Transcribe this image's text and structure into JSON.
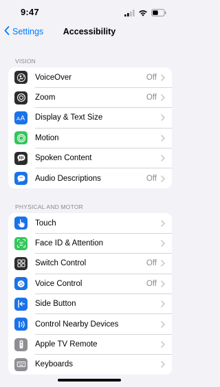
{
  "status_bar": {
    "time": "9:47"
  },
  "nav": {
    "back_label": "Settings",
    "title": "Accessibility"
  },
  "colors": {
    "accent": "#007aff",
    "background": "#f2f2f7",
    "secondary_text": "#8a8a8e"
  },
  "sections": [
    {
      "header": "VISION",
      "items": [
        {
          "label": "VoiceOver",
          "value": "Off",
          "icon": "voiceover-icon",
          "icon_color": "#2c2c2e"
        },
        {
          "label": "Zoom",
          "value": "Off",
          "icon": "zoom-icon",
          "icon_color": "#2c2c2e"
        },
        {
          "label": "Display & Text Size",
          "value": "",
          "icon": "text-size-icon",
          "icon_color": "#1a73e8"
        },
        {
          "label": "Motion",
          "value": "",
          "icon": "motion-icon",
          "icon_color": "#34c759"
        },
        {
          "label": "Spoken Content",
          "value": "",
          "icon": "spoken-content-icon",
          "icon_color": "#2c2c2e"
        },
        {
          "label": "Audio Descriptions",
          "value": "Off",
          "icon": "audio-descriptions-icon",
          "icon_color": "#1a73e8"
        }
      ]
    },
    {
      "header": "PHYSICAL AND MOTOR",
      "items": [
        {
          "label": "Touch",
          "value": "",
          "icon": "touch-icon",
          "icon_color": "#1a73e8"
        },
        {
          "label": "Face ID & Attention",
          "value": "",
          "icon": "face-id-icon",
          "icon_color": "#34c759"
        },
        {
          "label": "Switch Control",
          "value": "Off",
          "icon": "switch-control-icon",
          "icon_color": "#2c2c2e"
        },
        {
          "label": "Voice Control",
          "value": "Off",
          "icon": "voice-control-icon",
          "icon_color": "#1a73e8"
        },
        {
          "label": "Side Button",
          "value": "",
          "icon": "side-button-icon",
          "icon_color": "#1a73e8"
        },
        {
          "label": "Control Nearby Devices",
          "value": "",
          "icon": "nearby-devices-icon",
          "icon_color": "#1a73e8"
        },
        {
          "label": "Apple TV Remote",
          "value": "",
          "icon": "tv-remote-icon",
          "icon_color": "#8e8e93"
        },
        {
          "label": "Keyboards",
          "value": "",
          "icon": "keyboard-icon",
          "icon_color": "#8e8e93"
        }
      ]
    }
  ]
}
